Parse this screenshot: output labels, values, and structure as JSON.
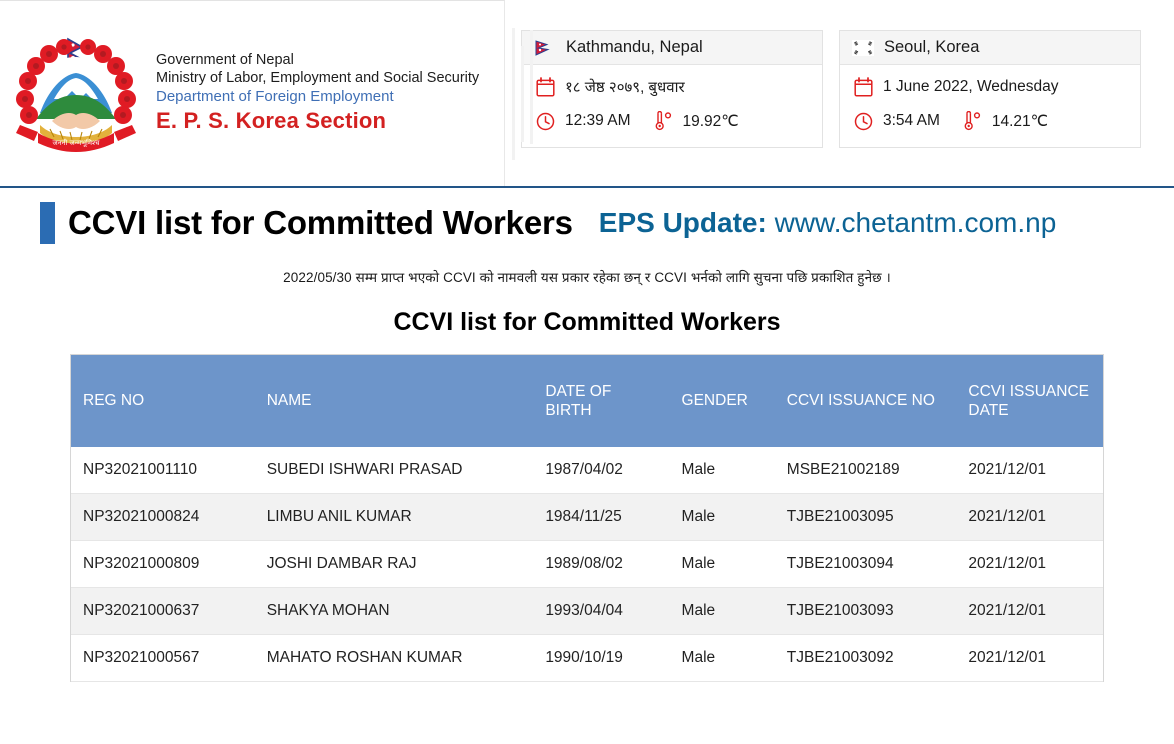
{
  "masthead": {
    "organization": {
      "line1": "Government of Nepal",
      "line2": "Ministry of Labor, Employment and Social Security",
      "line3": "Department of Foreign Employment",
      "line4": "E. P. S. Korea Section"
    },
    "cards": [
      {
        "flag_icon": "nepal-flag-icon",
        "city": "Kathmandu, Nepal",
        "calendar_icon": "calendar-icon",
        "date": "१८ जेष्ठ २०७९, बुधवार",
        "clock_icon": "clock-icon",
        "time": "12:39 AM",
        "thermometer_icon": "thermometer-icon",
        "temperature": "19.92℃"
      },
      {
        "flag_icon": "korea-flag-icon",
        "city": "Seoul, Korea",
        "calendar_icon": "calendar-icon",
        "date": "1 June 2022, Wednesday",
        "clock_icon": "clock-icon",
        "time": "3:54 AM",
        "thermometer_icon": "thermometer-icon",
        "temperature": "14.21℃"
      }
    ]
  },
  "page": {
    "title": "CCVI list for Committed Workers",
    "eps_update_label": "EPS Update:",
    "eps_update_url": "www.chetantm.com.np",
    "notice": "2022/05/30  सम्म प्राप्त भएको CCVI को नामवली यस प्रकार रहेका छन् र CCVI भर्नको लागि सुचना पछि प्रकाशित हुनेछ ।",
    "table_title": "CCVI list for Committed Workers"
  },
  "table": {
    "columns": [
      "REG NO",
      "NAME",
      "DATE OF BIRTH",
      "GENDER",
      "CCVI ISSUANCE NO",
      "CCVI ISSUANCE DATE"
    ],
    "rows": [
      {
        "reg_no": "NP32021001110",
        "name": "SUBEDI ISHWARI PRASAD",
        "dob": "1987/04/02",
        "gender": "Male",
        "ccvi_issuance_no": "MSBE21002189",
        "ccvi_issuance_date": "2021/12/01"
      },
      {
        "reg_no": "NP32021000824",
        "name": "LIMBU ANIL KUMAR",
        "dob": "1984/11/25",
        "gender": "Male",
        "ccvi_issuance_no": "TJBE21003095",
        "ccvi_issuance_date": "2021/12/01"
      },
      {
        "reg_no": "NP32021000809",
        "name": "JOSHI DAMBAR RAJ",
        "dob": "1989/08/02",
        "gender": "Male",
        "ccvi_issuance_no": "TJBE21003094",
        "ccvi_issuance_date": "2021/12/01"
      },
      {
        "reg_no": "NP32021000637",
        "name": "SHAKYA MOHAN",
        "dob": "1993/04/04",
        "gender": "Male",
        "ccvi_issuance_no": "TJBE21003093",
        "ccvi_issuance_date": "2021/12/01"
      },
      {
        "reg_no": "NP32021000567",
        "name": "MAHATO ROSHAN KUMAR",
        "dob": "1990/10/19",
        "gender": "Male",
        "ccvi_issuance_no": "TJBE21003092",
        "ccvi_issuance_date": "2021/12/01"
      }
    ]
  },
  "colors": {
    "accent_bar": "#2b6cb3",
    "eps_update": "#0c6394",
    "table_header": "#6d95ca",
    "org_red": "#d32121",
    "org_blue": "#3f6fb5",
    "divider": "#225588"
  }
}
